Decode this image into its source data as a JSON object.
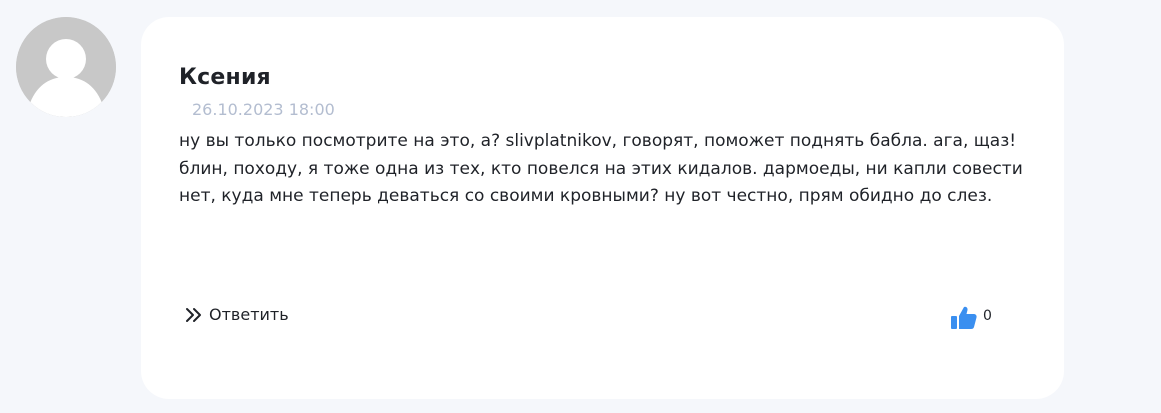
{
  "comment": {
    "author": "Ксения",
    "date": "26.10.2023 18:00",
    "text": "ну вы только посмотрите на это, а? slivplatnikov, говорят, поможет поднять бабла. ага, щаз! блин, походу, я тоже одна из тех, кто повелся на этих кидалов. дармоеды, ни капли совести нет, куда мне теперь деваться со своими кровными? ну вот честно, прям обидно до слез.",
    "avatar_icon": "user-placeholder-icon",
    "reply": {
      "icon": "double-chevron-right-icon",
      "label": "Ответить"
    },
    "like": {
      "icon": "thumbs-up-icon",
      "count": "0"
    }
  },
  "colors": {
    "background": "#f5f7fb",
    "card": "#ffffff",
    "date": "#b3bdd0",
    "like_icon": "#3a8ff0",
    "avatar": "#c8c8c8"
  }
}
